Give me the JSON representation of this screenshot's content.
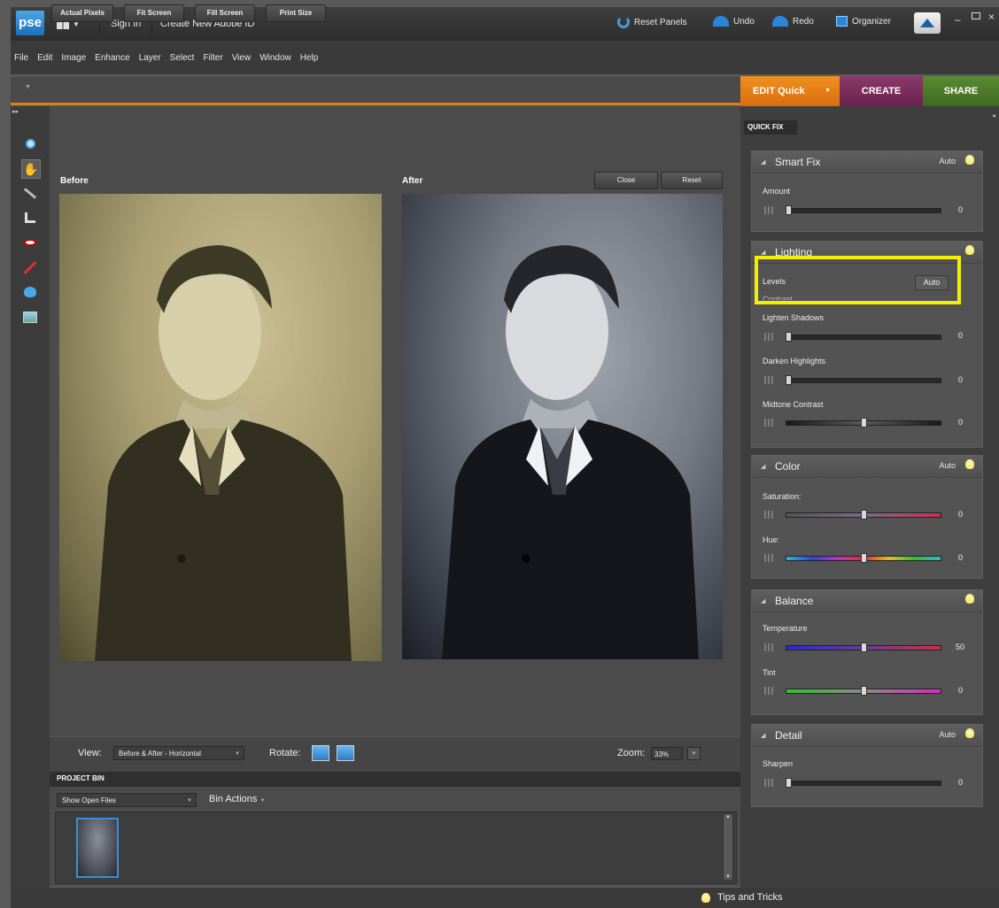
{
  "titlebar": {
    "logo": "pse",
    "sign_in": "Sign In",
    "create_id": "Create New Adobe ID",
    "reset_panels": "Reset Panels",
    "undo": "Undo",
    "redo": "Redo",
    "organizer": "Organizer"
  },
  "menu": [
    "File",
    "Edit",
    "Image",
    "Enhance",
    "Layer",
    "Select",
    "Filter",
    "View",
    "Window",
    "Help"
  ],
  "options": {
    "actual_pixels": "Actual Pixels",
    "fit_screen": "Fit Screen",
    "fill_screen": "Fill Screen",
    "print_size": "Print Size"
  },
  "modes": {
    "edit": "EDIT Quick",
    "create": "CREATE",
    "share": "SHARE"
  },
  "canvas": {
    "before_label": "Before",
    "after_label": "After",
    "close": "Close",
    "reset": "Reset"
  },
  "viewbar": {
    "view_label": "View:",
    "view_value": "Before & After - Horizontal",
    "rotate_label": "Rotate:",
    "zoom_label": "Zoom:",
    "zoom_value": "33%"
  },
  "bin": {
    "title": "PROJECT BIN",
    "show": "Show Open Files",
    "actions": "Bin Actions"
  },
  "status": {
    "tips": "Tips and Tricks"
  },
  "panel": {
    "tab": "QUICK FIX",
    "smart_fix": {
      "title": "Smart Fix",
      "auto": "Auto",
      "amount_label": "Amount",
      "amount_value": "0"
    },
    "lighting": {
      "title": "Lighting",
      "levels": "Levels",
      "levels_auto": "Auto",
      "contrast_hidden": "Contrast",
      "lighten_label": "Lighten Shadows",
      "lighten_value": "0",
      "darken_label": "Darken Highlights",
      "darken_value": "0",
      "midtone_label": "Midtone Contrast",
      "midtone_value": "0"
    },
    "color": {
      "title": "Color",
      "auto": "Auto",
      "saturation_label": "Saturation:",
      "saturation_value": "0",
      "hue_label": "Hue:",
      "hue_value": "0"
    },
    "balance": {
      "title": "Balance",
      "temperature_label": "Temperature",
      "temperature_value": "50",
      "tint_label": "Tint",
      "tint_value": "0"
    },
    "detail": {
      "title": "Detail",
      "auto": "Auto",
      "sharpen_label": "Sharpen",
      "sharpen_value": "0"
    }
  },
  "colors": {
    "accent_orange": "#e07b1a",
    "create_purple": "#7a2a5a",
    "share_green": "#4a7a2a",
    "highlight_yellow": "#f0f000"
  }
}
